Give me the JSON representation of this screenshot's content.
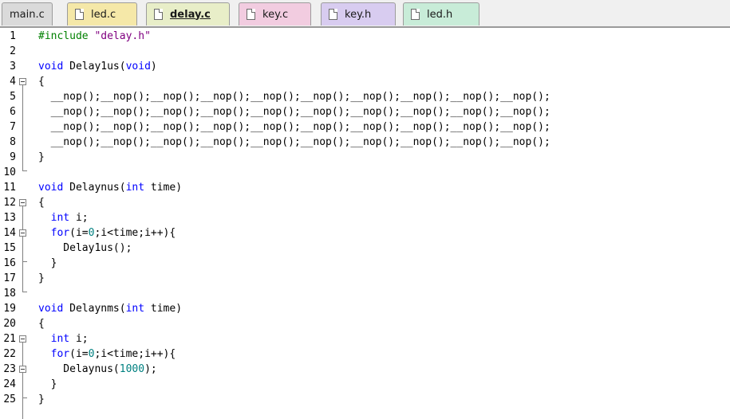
{
  "tabs": [
    {
      "label": "main.c",
      "color": "#dadada",
      "icon": false,
      "active": false
    },
    {
      "label": "led.c",
      "color": "#f5e8a8",
      "icon": true,
      "active": false
    },
    {
      "label": "delay.c",
      "color": "#e8eec8",
      "icon": true,
      "active": true
    },
    {
      "label": "key.c",
      "color": "#f2cce0",
      "icon": true,
      "active": false
    },
    {
      "label": "key.h",
      "color": "#d8ccf0",
      "icon": true,
      "active": false
    },
    {
      "label": "led.h",
      "color": "#c8ecd8",
      "icon": true,
      "active": false
    }
  ],
  "line_numbers": [
    "1",
    "2",
    "3",
    "4",
    "5",
    "6",
    "7",
    "8",
    "9",
    "10",
    "11",
    "12",
    "13",
    "14",
    "15",
    "16",
    "17",
    "18",
    "19",
    "20",
    "21",
    "22",
    "23",
    "24",
    "25"
  ],
  "code": {
    "l1_directive": "#include",
    "l1_string": "\"delay.h\"",
    "l3_void": "void",
    "l3_name": " Delay1us(",
    "l3_param": "void",
    "l3_close": ")",
    "l4": "{",
    "l5": "  __nop();__nop();__nop();__nop();__nop();__nop();__nop();__nop();__nop();__nop();",
    "l6": "  __nop();__nop();__nop();__nop();__nop();__nop();__nop();__nop();__nop();__nop();",
    "l7": "  __nop();__nop();__nop();__nop();__nop();__nop();__nop();__nop();__nop();__nop();",
    "l8": "  __nop();__nop();__nop();__nop();__nop();__nop();__nop();__nop();__nop();__nop();",
    "l9": "}",
    "l11_void": "void",
    "l11_name": " Delaynus(",
    "l11_int": "int",
    "l11_rest": " time)",
    "l12": "{",
    "l13_int": "int",
    "l13_rest": " i;",
    "l14_for": "for",
    "l14_a": "(i=",
    "l14_zero": "0",
    "l14_b": ";i<time;i++){",
    "l15": "    Delay1us();",
    "l16": "  }",
    "l17": "}",
    "l19_void": "void",
    "l19_name": " Delaynms(",
    "l19_int": "int",
    "l19_rest": " time)",
    "l20": "{",
    "l21_int": "int",
    "l21_rest": " i;",
    "l22_for": "for",
    "l22_a": "(i=",
    "l22_zero": "0",
    "l22_b": ";i<time;i++){",
    "l23_a": "    Delaynus(",
    "l23_num": "1000",
    "l23_b": ");",
    "l24": "  }",
    "l25": "}"
  },
  "fold_markers": {
    "collapse_icon": "minus-box-icon"
  }
}
